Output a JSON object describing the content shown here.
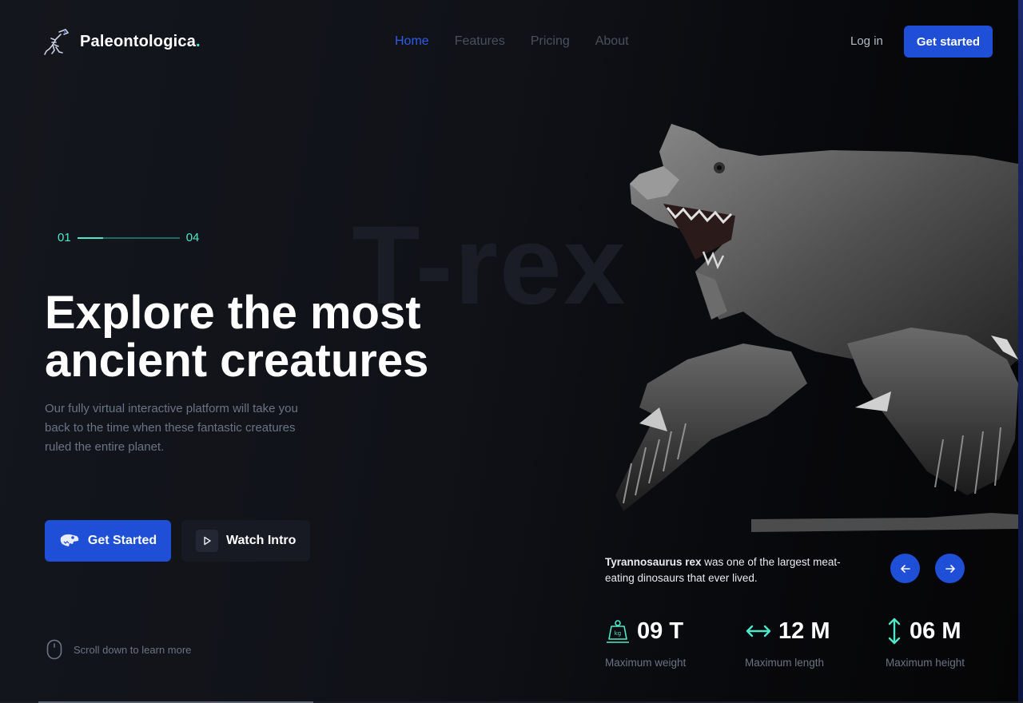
{
  "brand": {
    "name": "Paleontologica",
    "dot": ".",
    "icon": "dinosaur-skeleton-icon"
  },
  "nav": {
    "items": [
      "Home",
      "Features",
      "Pricing",
      "About"
    ],
    "active": "Home"
  },
  "header": {
    "login_label": "Log in",
    "cta_label": "Get started"
  },
  "progress": {
    "current": "01",
    "total": "04",
    "fill_fraction": 0.25
  },
  "watermark": "T-rex",
  "hero": {
    "title_line1": "Explore the most",
    "title_line2": "ancient creatures",
    "subtitle": "Our fully virtual interactive platform will take you back to the time when these fantastic creatures ruled the entire planet.",
    "primary_button": "Get Started",
    "secondary_button": "Watch Intro"
  },
  "scroll_hint": "Scroll down to learn more",
  "dino_info": {
    "name": "Tyrannosaurus rex",
    "description": " was one of the largest meat-eating dinosaurs that ever lived."
  },
  "stats": [
    {
      "value": "09 T",
      "label": "Maximum weight",
      "icon": "weight-icon"
    },
    {
      "value": "12 M",
      "label": "Maximum length",
      "icon": "horizontal-arrows-icon"
    },
    {
      "value": "06 M",
      "label": "Maximum height",
      "icon": "vertical-arrows-icon"
    }
  ],
  "colors": {
    "accent": "#1f4fd6",
    "teal": "#4ee8c8",
    "background": "#101218",
    "muted": "#6c7384"
  }
}
